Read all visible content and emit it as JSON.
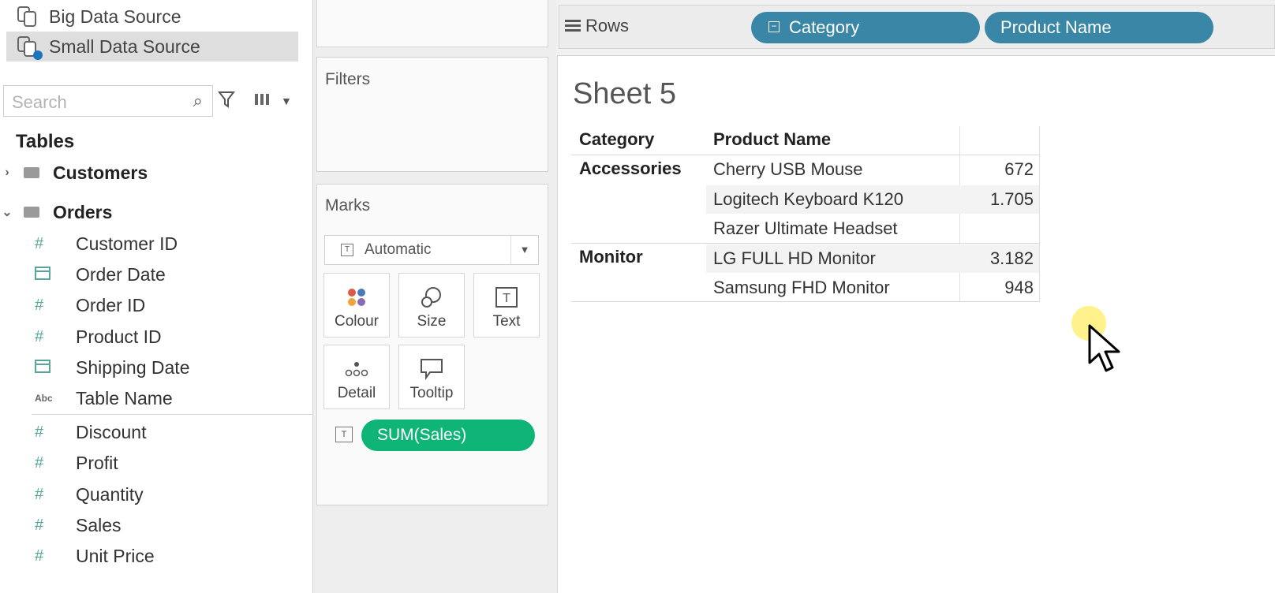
{
  "data_sources": [
    {
      "label": "Big Data Source",
      "selected": false
    },
    {
      "label": "Small Data Source",
      "selected": true
    }
  ],
  "search": {
    "placeholder": "Search"
  },
  "tables_title": "Tables",
  "tables": [
    {
      "label": "Customers",
      "expanded": false
    },
    {
      "label": "Orders",
      "expanded": true
    }
  ],
  "fields": [
    {
      "label": "Customer ID",
      "type": "number-icon"
    },
    {
      "label": "Order Date",
      "type": "calendar-icon"
    },
    {
      "label": "Order ID",
      "type": "number-icon"
    },
    {
      "label": "Product ID",
      "type": "number-icon"
    },
    {
      "label": "Shipping Date",
      "type": "calendar-icon"
    },
    {
      "label": "Table Name",
      "type": "string-icon"
    },
    {
      "label": "Discount",
      "type": "number-icon"
    },
    {
      "label": "Profit",
      "type": "number-icon"
    },
    {
      "label": "Quantity",
      "type": "number-icon"
    },
    {
      "label": "Sales",
      "type": "number-icon"
    },
    {
      "label": "Unit Price",
      "type": "number-icon"
    }
  ],
  "cards": {
    "filters": "Filters",
    "marks": "Marks"
  },
  "marks": {
    "type": "Automatic",
    "buttons": {
      "colour": "Colour",
      "size": "Size",
      "text": "Text",
      "detail": "Detail",
      "tooltip": "Tooltip"
    },
    "pill": "SUM(Sales)"
  },
  "rows_shelf": {
    "label": "Rows",
    "pills": [
      "Category",
      "Product Name"
    ]
  },
  "sheet": {
    "title": "Sheet 5",
    "headers": [
      "Category",
      "Product Name"
    ],
    "rows": [
      {
        "category": "Accessories",
        "product": "Cherry USB Mouse",
        "value": "672"
      },
      {
        "category": "",
        "product": "Logitech Keyboard K120",
        "value": "1.705"
      },
      {
        "category": "",
        "product": "Razer Ultimate Headset",
        "value": ""
      },
      {
        "category": "Monitor",
        "product": "LG FULL HD Monitor",
        "value": "3.182"
      },
      {
        "category": "",
        "product": "Samsung FHD Monitor",
        "value": "948"
      }
    ]
  },
  "colors": {
    "accent_green": "#0fb477",
    "accent_blue": "#3a86a6",
    "field_teal": "#5aa59b"
  }
}
